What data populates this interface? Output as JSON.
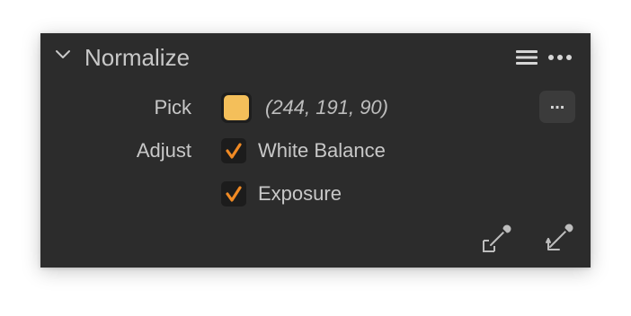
{
  "panel": {
    "title": "Normalize",
    "collapsed": false
  },
  "pick": {
    "label": "Pick",
    "value_text": "(244, 191, 90)",
    "swatch_color": "#F4BF5A",
    "options_button_label": "..."
  },
  "adjust": {
    "label": "Adjust",
    "options": [
      {
        "label": "White Balance",
        "checked": true
      },
      {
        "label": "Exposure",
        "checked": true
      }
    ]
  },
  "colors": {
    "panel_bg": "#2C2C2C",
    "check_accent": "#F08A24",
    "text": "#C8C8C8"
  },
  "icons": {
    "header_left": "chevron-down-icon",
    "header_menu": "hamburger-menu-icon",
    "header_more": "more-horizontal-icon",
    "bottom_left": "picker-target-icon",
    "bottom_right": "picker-apply-icon"
  }
}
